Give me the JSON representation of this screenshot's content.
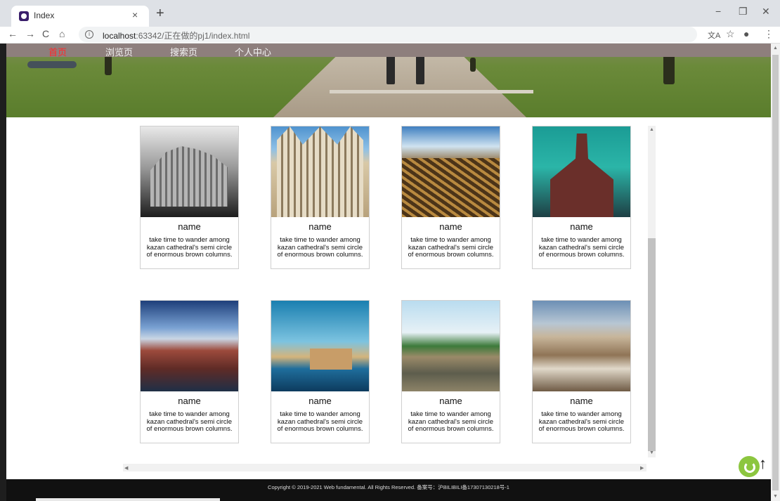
{
  "browser": {
    "tab_title": "Index",
    "tab_close": "×",
    "new_tab": "+",
    "window_controls": [
      "−",
      "❐",
      "✕"
    ],
    "nav_buttons": [
      "←",
      "→",
      "C",
      "⌂"
    ],
    "url_host": "localhost",
    "url_rest": ":63342/正在做的pj1/index.html",
    "toolbar_icons": [
      "translate-icon",
      "star-icon",
      "profile-icon",
      "menu-icon"
    ]
  },
  "site": {
    "nav": [
      "首页",
      "浏览页",
      "搜索页",
      "个人中心"
    ],
    "active_color": "#ff2a2a",
    "cards": [
      {
        "name": "name",
        "desc": "take time to wander among kazan cathedral's semi circle of enormous brown columns.",
        "image": "gothic-cathedral-bw"
      },
      {
        "name": "name",
        "desc": "take time to wander among kazan cathedral's semi circle of enormous brown columns.",
        "image": "cathedral-facade"
      },
      {
        "name": "name",
        "desc": "take time to wander among kazan cathedral's semi circle of enormous brown columns.",
        "image": "rusty-keys"
      },
      {
        "name": "name",
        "desc": "take time to wander among kazan cathedral's semi circle of enormous brown columns.",
        "image": "church-teal-sky"
      },
      {
        "name": "name",
        "desc": "take time to wander among kazan cathedral's semi circle of enormous brown columns.",
        "image": "harbor-town"
      },
      {
        "name": "name",
        "desc": "take time to wander among kazan cathedral's semi circle of enormous brown columns.",
        "image": "city-waterfront"
      },
      {
        "name": "name",
        "desc": "take time to wander among kazan cathedral's semi circle of enormous brown columns.",
        "image": "tropical-beach"
      },
      {
        "name": "name",
        "desc": "take time to wander among kazan cathedral's semi circle of enormous brown columns.",
        "image": "hillside-town"
      }
    ],
    "copyright": "Copyright © 2019-2021 Web fundamental. All Rights Reserved. 备案号：沪BILIBILI备17307130218号-1",
    "back_to_top": "↑"
  }
}
